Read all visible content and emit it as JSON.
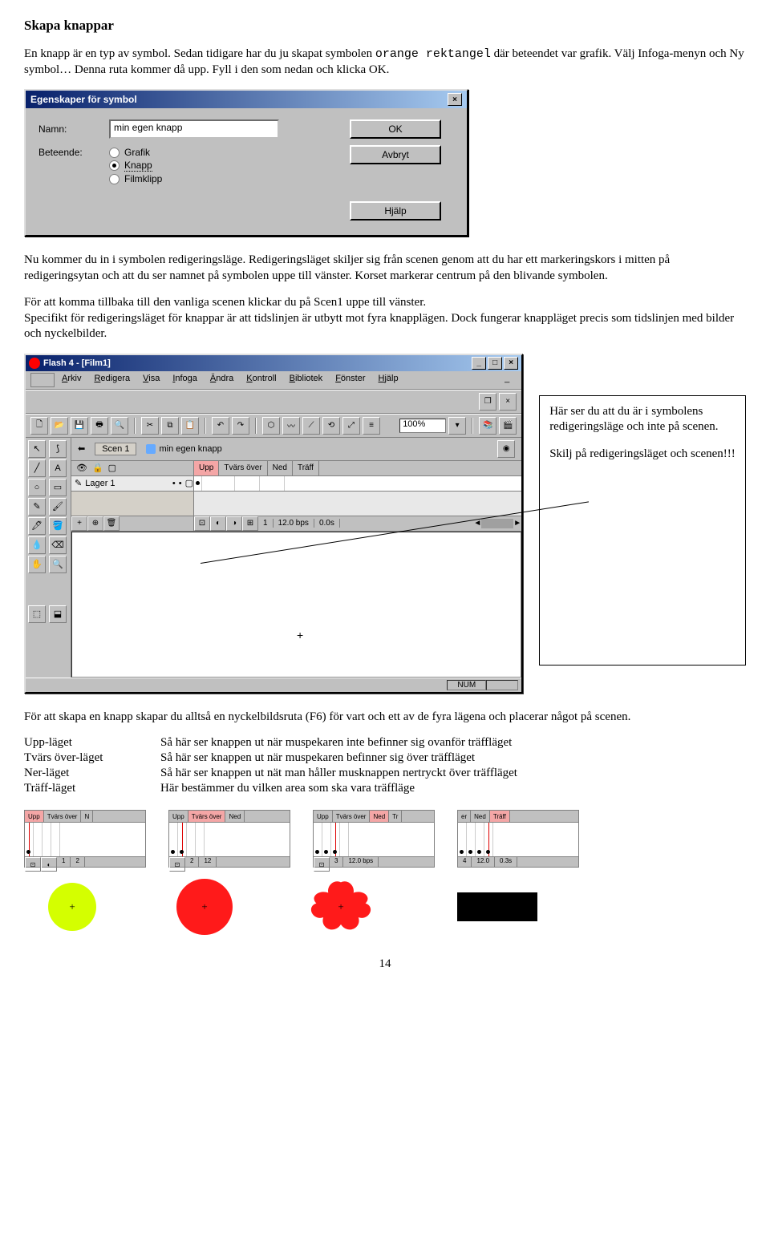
{
  "page": {
    "title": "Skapa knappar",
    "intro": "En knapp är en typ av symbol. Sedan tidigare har du ju skapat symbolen ",
    "intro_code": "orange rektangel",
    "intro2": " där beteendet var grafik. Välj Infoga-menyn och Ny symbol… Denna ruta kommer då upp. Fyll i den som nedan och klicka OK."
  },
  "dialog1": {
    "title": "Egenskaper för symbol",
    "name_label": "Namn:",
    "name_value": "min egen knapp",
    "beh_label": "Beteende:",
    "opt_grafik": "Grafik",
    "opt_knapp": "Knapp",
    "opt_film": "Filmklipp",
    "btn_ok": "OK",
    "btn_cancel": "Avbryt",
    "btn_help": "Hjälp"
  },
  "para2": {
    "p1": "Nu kommer du in i symbolen redigeringsläge. Redigeringsläget skiljer sig från scenen genom att du har ett markeringskors i mitten på redigeringsytan och att du ser namnet på symbolen uppe till vänster. Korset markerar centrum på den blivande symbolen.",
    "p2": "För att komma tillbaka till den vanliga scenen klickar du på Scen1 uppe till vänster.",
    "p3": "Specifikt för redigeringsläget för knappar är att tidslinjen är utbytt mot fyra knapplägen. Dock fungerar knappläget precis som tidslinjen med bilder och nyckelbilder."
  },
  "app": {
    "title": "Flash 4 - [Film1]",
    "menus": [
      "Arkiv",
      "Redigera",
      "Visa",
      "Infoga",
      "Ändra",
      "Kontroll",
      "Bibliotek",
      "Fönster",
      "Hjälp"
    ],
    "zoom": "100%",
    "scene_tab": "Scen 1",
    "symbol_name": "min egen knapp",
    "frame_tabs": [
      "Upp",
      "Tvärs över",
      "Ned",
      "Träff"
    ],
    "layer": "Lager 1",
    "frame_num": "1",
    "fps": "12.0 bps",
    "time": "0.0s",
    "status": "NUM"
  },
  "sidebox": {
    "p1": "Här ser du att du är i symbolens redigeringsläge och inte på scenen.",
    "p2": "Skilj på redigeringsläget och scenen!!!"
  },
  "para3": "För att skapa en knapp skapar du alltså en nyckelbildsruta (F6) för vart och ett av de fyra lägena och placerar något på scenen.",
  "defs": {
    "r1c1": "Upp-läget",
    "r1c2": "Så här ser knappen ut när muspekaren inte befinner sig ovanför träffläget",
    "r2c1": "Tvärs över-läget",
    "r2c2": "Så här ser knappen ut när muspekaren befinner sig över träffläget",
    "r3c1": "Ner-läget",
    "r3c2": "Så här ser knappen ut nät man håller musknappen nertryckt över träffläget",
    "r4c1": "Träff-läget",
    "r4c2": "Här bestämmer du vilken area som ska vara träffläge"
  },
  "thumbs": {
    "t1": {
      "tabs": [
        "Upp",
        "Tvärs över",
        "N"
      ],
      "active": 0,
      "footer": [
        "1",
        "2"
      ]
    },
    "t2": {
      "tabs": [
        "Upp",
        "Tvärs över",
        "Ned"
      ],
      "active": 1,
      "footer": [
        "2",
        "12"
      ]
    },
    "t3": {
      "tabs": [
        "Upp",
        "Tvärs över",
        "Ned",
        "Tr"
      ],
      "active": 2,
      "footer": [
        "3",
        "12.0 bps"
      ]
    },
    "t4": {
      "tabs": [
        "er",
        "Ned",
        "Träff"
      ],
      "active": 2,
      "footer": [
        "4",
        "12.0",
        "0.3s"
      ]
    }
  },
  "pagenum": "14"
}
